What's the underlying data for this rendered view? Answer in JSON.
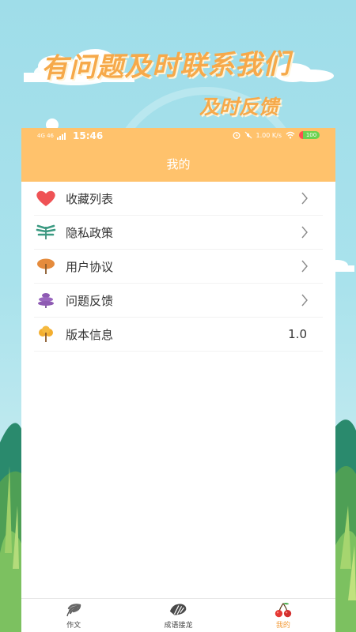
{
  "banner": {
    "headline": "有问题及时联系我们",
    "subline": "及时反馈"
  },
  "status_bar": {
    "network": "4G 46",
    "time": "15:46",
    "speed": "1.00 K/s",
    "battery": "100"
  },
  "header": {
    "title": "我的"
  },
  "menu": [
    {
      "label": "收藏列表",
      "icon": "heart-icon"
    },
    {
      "label": "隐私政策",
      "icon": "green-leaf-icon"
    },
    {
      "label": "用户协议",
      "icon": "orange-tree-icon"
    },
    {
      "label": "问题反馈",
      "icon": "purple-leaf-icon"
    },
    {
      "label": "版本信息",
      "icon": "yellow-tree-icon",
      "value": "1.0"
    }
  ],
  "tabs": [
    {
      "label": "作文",
      "icon": "palm-leaf-icon",
      "active": false
    },
    {
      "label": "成语接龙",
      "icon": "monstera-leaf-icon",
      "active": false
    },
    {
      "label": "我的",
      "icon": "cherry-icon",
      "active": true
    }
  ],
  "colors": {
    "accent": "#ffc26c",
    "active_tab": "#f39c3b",
    "sky": "#a9e2ec"
  }
}
